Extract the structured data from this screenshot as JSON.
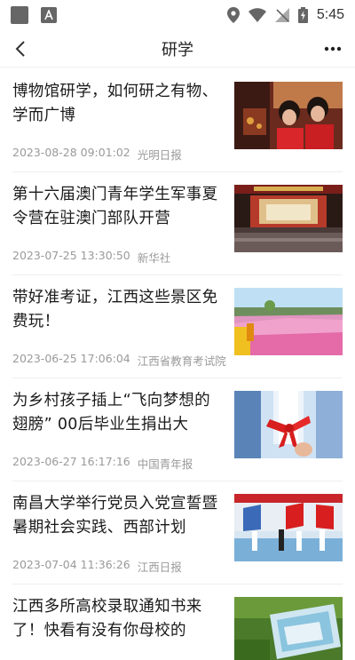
{
  "status": {
    "time": "5:45"
  },
  "appbar": {
    "title": "研学"
  },
  "articles": [
    {
      "title": "博物馆研学，如何研之有物、学而广博",
      "time": "2023-08-28 09:01:02",
      "source": "光明日报",
      "thumb": "museum-visit-photo"
    },
    {
      "title": "第十六届澳门青年学生军事夏令营在驻澳门部队开营",
      "time": "2023-07-25 13:30:50",
      "source": "新华社",
      "thumb": "auditorium-stage-photo"
    },
    {
      "title": "带好准考证，江西这些景区免费玩！",
      "time": "2023-06-25 17:06:04",
      "source": "江西省教育考试院",
      "thumb": "flower-field-photo"
    },
    {
      "title": "为乡村孩子插上“飞向梦想的翅膀” 00后毕业生捐出大",
      "time": "2023-06-27 16:17:16",
      "source": "中国青年报",
      "thumb": "diploma-ribbon-photo"
    },
    {
      "title": "南昌大学举行党员入党宣誓暨暑期社会实践、西部计划",
      "time": "2023-07-04 11:36:26",
      "source": "江西日报",
      "thumb": "flag-ceremony-photo"
    },
    {
      "title": "江西多所高校录取通知书来了！快看有没有你母校的",
      "time": "",
      "source": "",
      "thumb": "admission-letter-photo"
    }
  ]
}
